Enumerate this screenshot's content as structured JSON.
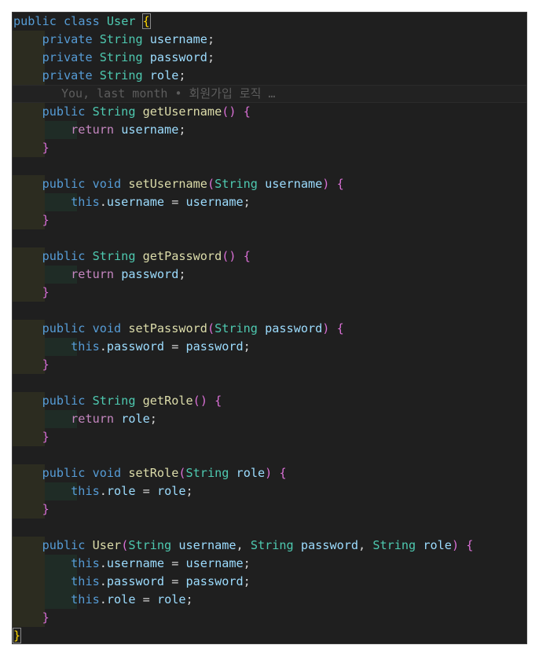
{
  "editor": {
    "blame": "You, last month • 회원가입 로직 …",
    "lines": [
      "public class User {",
      "    private String username;",
      "    private String password;",
      "    private String role;",
      "",
      "    public String getUsername() {",
      "        return username;",
      "    }",
      "",
      "    public void setUsername(String username) {",
      "        this.username = username;",
      "    }",
      "",
      "    public String getPassword() {",
      "        return password;",
      "    }",
      "",
      "    public void setPassword(String password) {",
      "        this.password = password;",
      "    }",
      "",
      "    public String getRole() {",
      "        return role;",
      "    }",
      "",
      "    public void setRole(String role) {",
      "        this.role = role;",
      "    }",
      "",
      "    public User(String username, String password, String role) {",
      "        this.username = username;",
      "        this.password = password;",
      "        this.role = role;",
      "    }",
      "}"
    ]
  },
  "theme": {
    "background": "#1f1f1f",
    "keyword": "#569cd6",
    "type": "#4ec9b0",
    "function": "#dcdcaa",
    "control": "#c586c0",
    "variable": "#9cdcfe",
    "bracket_level1": "#ffd700",
    "bracket_level2": "#da70d6"
  }
}
